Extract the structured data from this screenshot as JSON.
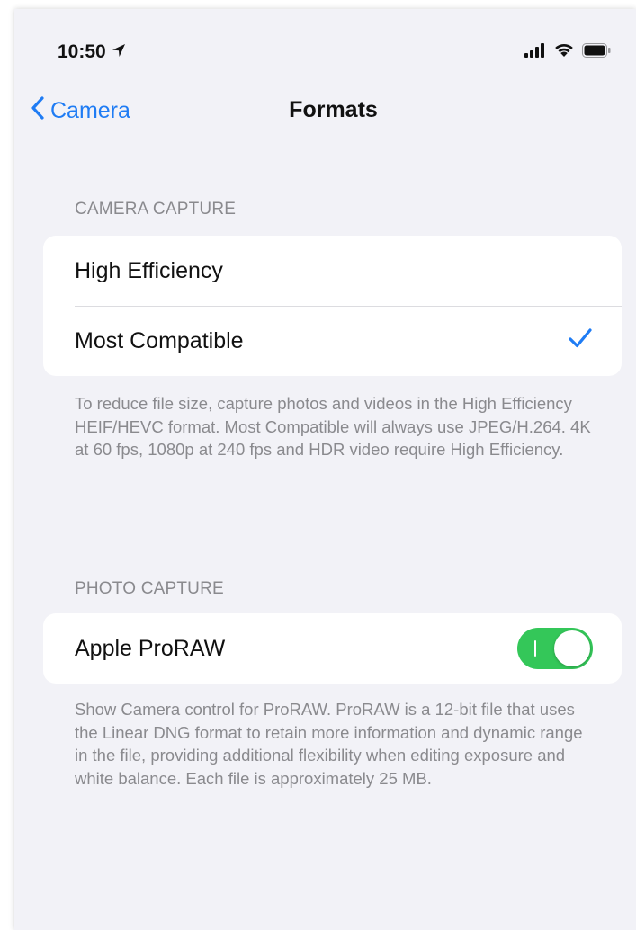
{
  "status_bar": {
    "time": "10:50",
    "icons": [
      "location-arrow-icon",
      "signal-icon",
      "wifi-icon",
      "battery-icon"
    ]
  },
  "nav": {
    "back_label": "Camera",
    "title": "Formats"
  },
  "camera_capture": {
    "header": "CAMERA CAPTURE",
    "options": [
      {
        "label": "High Efficiency",
        "selected": false
      },
      {
        "label": "Most Compatible",
        "selected": true
      }
    ],
    "footer": "To reduce file size, capture photos and videos in the High Efficiency HEIF/HEVC format. Most Compatible will always use JPEG/H.264. 4K at 60 fps, 1080p at 240 fps and HDR video require High Efficiency."
  },
  "photo_capture": {
    "header": "PHOTO CAPTURE",
    "proraw_label": "Apple ProRAW",
    "proraw_enabled": true,
    "footer": "Show Camera control for ProRAW. ProRAW is a 12-bit file that uses the Linear DNG format to retain more information and dynamic range in the file, providing additional flexibility when editing exposure and white balance. Each file is approximately 25 MB."
  },
  "colors": {
    "accent": "#1f7cf4",
    "toggle_on": "#34c759",
    "background": "#f2f2f7",
    "secondary_text": "#8a8a8e"
  }
}
